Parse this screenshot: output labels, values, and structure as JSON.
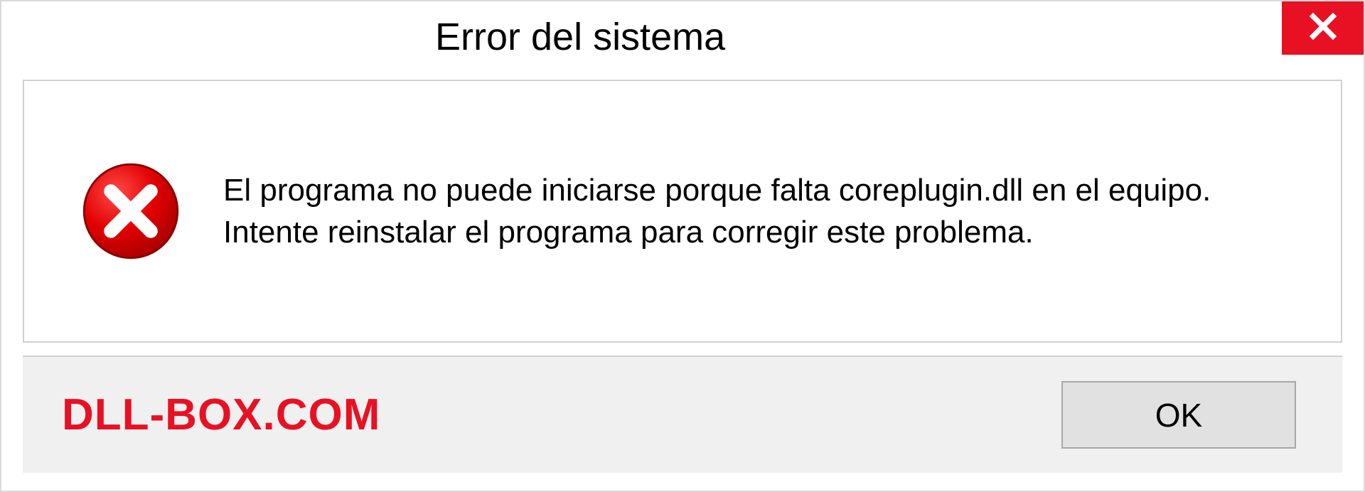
{
  "titlebar": {
    "title": "Error del sistema"
  },
  "message": {
    "line1": "El programa no puede iniciarse porque falta coreplugin.dll en el equipo.",
    "line2": "Intente reinstalar el programa para corregir este problema."
  },
  "footer": {
    "watermark": "DLL-BOX.COM",
    "ok_label": "OK"
  },
  "colors": {
    "close_bg": "#e81123",
    "error_icon": "#d40000",
    "watermark": "#e81123"
  }
}
